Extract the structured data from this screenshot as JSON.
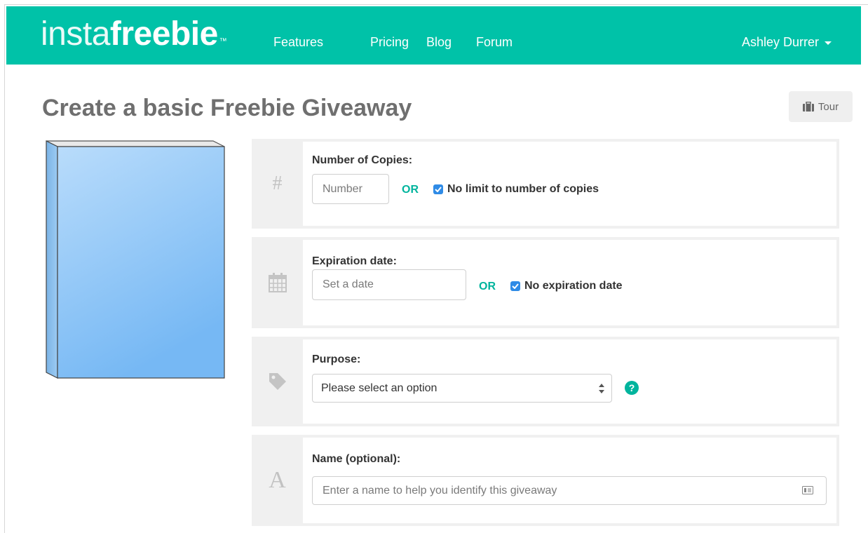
{
  "navbar": {
    "logo_thin": "insta",
    "logo_bold": "freebie",
    "logo_tm": "™",
    "links": [
      "Features",
      "Pricing",
      "Blog",
      "Forum"
    ],
    "user": "Ashley Durrer"
  },
  "page": {
    "title": "Create a basic Freebie Giveaway",
    "tour_label": "Tour"
  },
  "form": {
    "copies": {
      "label": "Number of Copies:",
      "placeholder": "Number",
      "or": "OR",
      "checkbox_label": "No limit to number of copies",
      "checked": true
    },
    "expiration": {
      "label": "Expiration date:",
      "placeholder": "Set a date",
      "or": "OR",
      "checkbox_label": "No expiration date",
      "checked": true
    },
    "purpose": {
      "label": "Purpose:",
      "selected": "Please select an option",
      "help": "?"
    },
    "name": {
      "label": "Name (optional):",
      "placeholder": "Enter a name to help you identify this giveaway"
    }
  },
  "icons": {
    "copies": "hash-icon",
    "expiration": "calendar-icon",
    "purpose": "tag-icon",
    "name": "letter-a-icon",
    "row_icon_glyphs": {
      "copies": "#",
      "name": "A"
    }
  },
  "colors": {
    "brand": "#00c2a8",
    "accent": "#00b49d",
    "checkbox": "#2f8be6"
  }
}
